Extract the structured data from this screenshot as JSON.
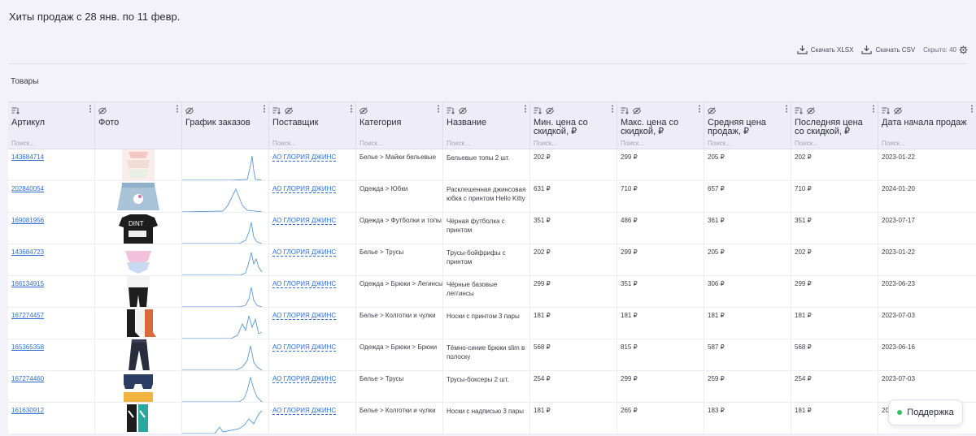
{
  "page": {
    "title": "Хиты продаж с 28 янв. по 11 февр."
  },
  "toolbar": {
    "xlsx_label": "Скачать XLSX",
    "csv_label": "Скачать CSV",
    "hidden_label": "Скрыто: 40"
  },
  "section": {
    "title": "Товары"
  },
  "table": {
    "search_placeholder": "Поиск...",
    "columns": [
      {
        "title": "Артикул",
        "icons": [
          "sort-icon"
        ],
        "search": true
      },
      {
        "title": "Фото",
        "icons": [
          "hide-icon"
        ],
        "search": false
      },
      {
        "title": "График заказов",
        "icons": [
          "hide-icon"
        ],
        "search": false
      },
      {
        "title": "Поставщик",
        "icons": [
          "sort-icon",
          "hide-icon"
        ],
        "search": true
      },
      {
        "title": "Категория",
        "icons": [
          "hide-icon"
        ],
        "search": true
      },
      {
        "title": "Название",
        "icons": [
          "sort-icon",
          "hide-icon"
        ],
        "search": true
      },
      {
        "title": "Мин. цена со скидкой, ₽",
        "icons": [
          "sort-icon",
          "hide-icon"
        ],
        "search": true
      },
      {
        "title": "Макс. цена со скидкой, ₽",
        "icons": [
          "sort-icon",
          "hide-icon"
        ],
        "search": true
      },
      {
        "title": "Средняя цена продаж, ₽",
        "icons": [
          "hide-icon"
        ],
        "search": true
      },
      {
        "title": "Последняя цена со скидкой, ₽",
        "icons": [
          "sort-icon",
          "hide-icon"
        ],
        "search": true
      },
      {
        "title": "Дата начала продаж",
        "icons": [
          "sort-icon",
          "hide-icon"
        ],
        "search": true
      }
    ],
    "rows": [
      {
        "article": "143684714",
        "supplier": "АО ГЛОРИЯ ДЖИНС",
        "category": "Белье   > Майки бельевые",
        "name": "Бельевые топы 2 шт.",
        "min": "202 ₽",
        "max": "299 ₽",
        "avg": "205 ₽",
        "last": "202 ₽",
        "date": "2023-01-22",
        "photo": "tops"
      },
      {
        "article": "202840054",
        "supplier": "АО ГЛОРИЯ ДЖИНС",
        "category": "Одежда   > Юбки",
        "name": "Расклешенная джинсовая юбка с принтом Hello Kitty",
        "min": "631 ₽",
        "max": "710 ₽",
        "avg": "657 ₽",
        "last": "710 ₽",
        "date": "2024-01-20",
        "photo": "skirt"
      },
      {
        "article": "169081956",
        "supplier": "АО ГЛОРИЯ ДЖИНС",
        "category": "Одежда   > Футболки и топы",
        "name": "Чёрная футболка с принтом",
        "min": "351 ₽",
        "max": "486 ₽",
        "avg": "361 ₽",
        "last": "351 ₽",
        "date": "2023-07-17",
        "photo": "tshirt"
      },
      {
        "article": "143684723",
        "supplier": "АО ГЛОРИЯ ДЖИНС",
        "category": "Белье   > Трусы",
        "name": "Трусы-бойфрифы с принтом",
        "min": "202 ₽",
        "max": "299 ₽",
        "avg": "205 ₽",
        "last": "202 ₽",
        "date": "2023-01-22",
        "photo": "briefs"
      },
      {
        "article": "166134915",
        "supplier": "АО ГЛОРИЯ ДЖИНС",
        "category": "Одежда   > Брюки   > Легинсы",
        "name": "Чёрные базовые леггинсы",
        "min": "299 ₽",
        "max": "351 ₽",
        "avg": "306 ₽",
        "last": "299 ₽",
        "date": "2023-06-23",
        "photo": "leggings"
      },
      {
        "article": "167274457",
        "supplier": "АО ГЛОРИЯ ДЖИНС",
        "category": "Белье   > Колготки и чулки",
        "name": "Носки с принтом 3 пары",
        "min": "181 ₽",
        "max": "181 ₽",
        "avg": "181 ₽",
        "last": "181 ₽",
        "date": "2023-07-03",
        "photo": "socks"
      },
      {
        "article": "165365358",
        "supplier": "АО ГЛОРИЯ ДЖИНС",
        "category": "Одежда   > Брюки   > Брюки",
        "name": "Тёмно-синие брюки slim в полоску",
        "min": "568 ₽",
        "max": "815 ₽",
        "avg": "587 ₽",
        "last": "568 ₽",
        "date": "2023-06-16",
        "photo": "pants"
      },
      {
        "article": "167274460",
        "supplier": "АО ГЛОРИЯ ДЖИНС",
        "category": "Белье   > Трусы",
        "name": "Трусы-боксеры 2 шт.",
        "min": "254 ₽",
        "max": "299 ₽",
        "avg": "259 ₽",
        "last": "254 ₽",
        "date": "2023-07-03",
        "photo": "boxers"
      },
      {
        "article": "161630912",
        "supplier": "АО ГЛОРИЯ ДЖИНС",
        "category": "Белье   > Колготки и чулки",
        "name": "Носки с надписью 3 пары",
        "min": "181 ₽",
        "max": "265 ₽",
        "avg": "183 ₽",
        "last": "181 ₽",
        "date": "2023-07-03",
        "photo": "socks2"
      }
    ]
  },
  "support": {
    "label": "Поддержка"
  },
  "colors": {
    "accent": "#2f6fd6",
    "spark": "#5b9bd5",
    "online": "#35c05a"
  }
}
